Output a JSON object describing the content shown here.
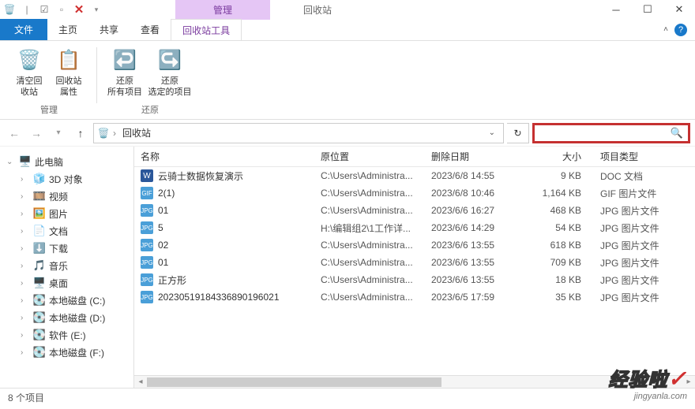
{
  "title_context": {
    "manage": "管理",
    "location": "回收站"
  },
  "tabs": {
    "file": "文件",
    "home": "主页",
    "share": "共享",
    "view": "查看",
    "tool": "回收站工具"
  },
  "ribbon": {
    "manage": {
      "empty": "清空回\n收站",
      "properties": "回收站\n属性",
      "label": "管理"
    },
    "restore": {
      "all": "还原\n所有项目",
      "selected": "还原\n选定的项目",
      "label": "还原"
    }
  },
  "breadcrumb": {
    "location": "回收站"
  },
  "columns": {
    "name": "名称",
    "origin": "原位置",
    "deleted": "删除日期",
    "size": "大小",
    "type": "项目类型"
  },
  "rows": [
    {
      "name": "云骑士数据恢复演示",
      "origin": "C:\\Users\\Administra...",
      "deleted": "2023/6/8 14:55",
      "size": "9 KB",
      "type": "DOC 文档",
      "icon": "doc",
      "badge": "W"
    },
    {
      "name": "2(1)",
      "origin": "C:\\Users\\Administra...",
      "deleted": "2023/6/8 10:46",
      "size": "1,164 KB",
      "type": "GIF 图片文件",
      "icon": "gif",
      "badge": "GIF"
    },
    {
      "name": "01",
      "origin": "C:\\Users\\Administra...",
      "deleted": "2023/6/6 16:27",
      "size": "468 KB",
      "type": "JPG 图片文件",
      "icon": "jpg",
      "badge": "JPG"
    },
    {
      "name": "5",
      "origin": "H:\\编辑组2\\1工作详...",
      "deleted": "2023/6/6 14:29",
      "size": "54 KB",
      "type": "JPG 图片文件",
      "icon": "jpg",
      "badge": "JPG"
    },
    {
      "name": "02",
      "origin": "C:\\Users\\Administra...",
      "deleted": "2023/6/6 13:55",
      "size": "618 KB",
      "type": "JPG 图片文件",
      "icon": "jpg",
      "badge": "JPG"
    },
    {
      "name": "01",
      "origin": "C:\\Users\\Administra...",
      "deleted": "2023/6/6 13:55",
      "size": "709 KB",
      "type": "JPG 图片文件",
      "icon": "jpg",
      "badge": "JPG"
    },
    {
      "name": "正方形",
      "origin": "C:\\Users\\Administra...",
      "deleted": "2023/6/6 13:55",
      "size": "18 KB",
      "type": "JPG 图片文件",
      "icon": "jpg",
      "badge": "JPG"
    },
    {
      "name": "20230519184336890196021",
      "origin": "C:\\Users\\Administra...",
      "deleted": "2023/6/5 17:59",
      "size": "35 KB",
      "type": "JPG 图片文件",
      "icon": "jpg",
      "badge": "JPG"
    }
  ],
  "sidebar": {
    "this_pc": "此电脑",
    "items": [
      {
        "label": "3D 对象",
        "icon": "🧊"
      },
      {
        "label": "视频",
        "icon": "🎞️"
      },
      {
        "label": "图片",
        "icon": "🖼️"
      },
      {
        "label": "文档",
        "icon": "📄"
      },
      {
        "label": "下载",
        "icon": "⬇️"
      },
      {
        "label": "音乐",
        "icon": "🎵"
      },
      {
        "label": "桌面",
        "icon": "🖥️"
      },
      {
        "label": "本地磁盘 (C:)",
        "icon": "💽"
      },
      {
        "label": "本地磁盘 (D:)",
        "icon": "💽"
      },
      {
        "label": "软件 (E:)",
        "icon": "💽"
      },
      {
        "label": "本地磁盘 (F:)",
        "icon": "💽"
      }
    ]
  },
  "status": "8 个项目",
  "watermark": {
    "main": "经验啦",
    "sub": "jingyanla.com"
  }
}
